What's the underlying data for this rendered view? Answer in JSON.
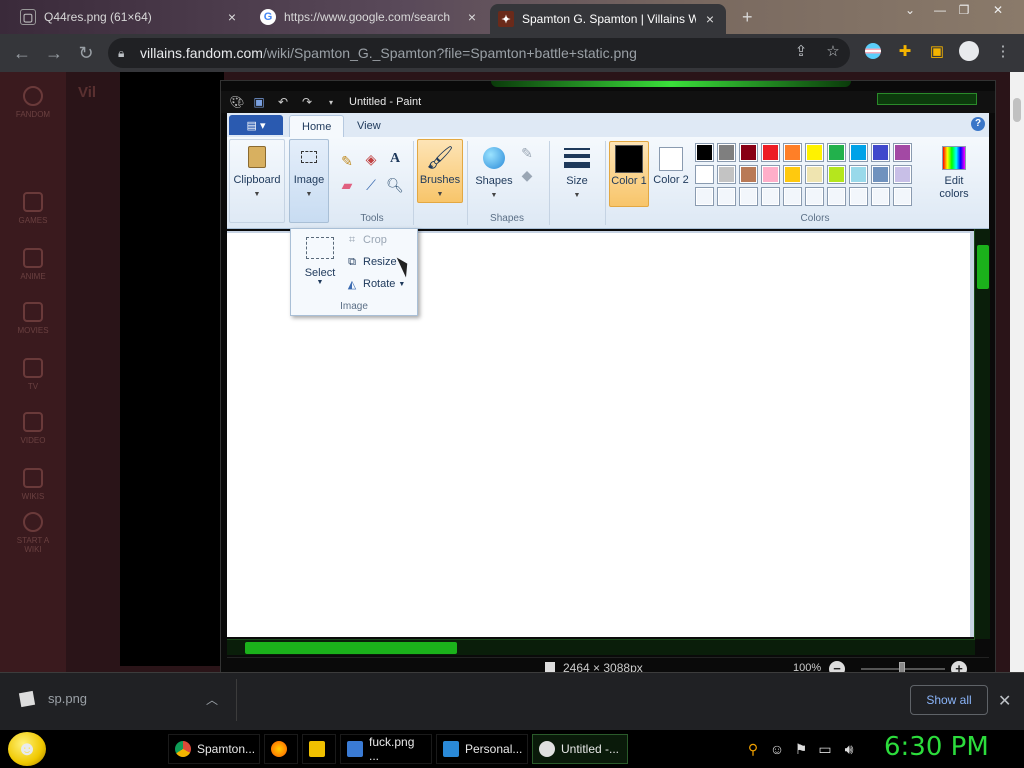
{
  "browser": {
    "tabs": [
      {
        "title": "Q44res.png (61×64)",
        "icon": "image-tab-icon"
      },
      {
        "title": "https://www.google.com/search",
        "icon": "google-icon"
      },
      {
        "title": "Spamton G. Spamton | Villains W",
        "icon": "fandom-icon"
      }
    ],
    "new_tab": "+",
    "url_host": "villains.fandom.com",
    "url_path": "/wiki/Spamton_G._Spamton?file=Spamton+battle+static.png"
  },
  "webpage": {
    "rail": [
      "FANDOM",
      "GAMES",
      "ANIME",
      "MOVIES",
      "TV",
      "VIDEO",
      "WIKIS",
      "START A WIKI"
    ],
    "logo_text": "Vil"
  },
  "paint": {
    "title": "Untitled - Paint",
    "tabs": [
      "Home",
      "View"
    ],
    "help": "?",
    "clipboard_label": "Clipboard",
    "image_label": "Image",
    "tools_label": "Tools",
    "brushes_label": "Brushes",
    "shapes_label": "Shapes",
    "shapes_group": "Shapes",
    "size_label": "Size",
    "color1_label": "Color 1",
    "color2_label": "Color 2",
    "colors_group": "Colors",
    "edit_colors_label": "Edit colors",
    "palette": [
      "#000000",
      "#7f7f7f",
      "#880015",
      "#ed1c24",
      "#ff7f27",
      "#fff200",
      "#22b14c",
      "#00a2e8",
      "#3f48cc",
      "#a349a4",
      "#ffffff",
      "#c3c3c3",
      "#b97a57",
      "#ffaec9",
      "#ffc90e",
      "#efe4b0",
      "#b5e61d",
      "#99d9ea",
      "#7092be",
      "#c8bfe7"
    ],
    "color1": "#000000",
    "color2": "#ffffff",
    "image_menu": {
      "select_label": "Select",
      "crop_label": "Crop",
      "resize_label": "Resize",
      "rotate_label": "Rotate",
      "group_label": "Image"
    },
    "status": {
      "dimensions": "2464 × 3088px",
      "zoom": "100%"
    }
  },
  "downloads": {
    "file": "sp.png",
    "show_all": "Show all"
  },
  "taskbar": {
    "items": [
      {
        "label": "Spamton...",
        "color": "#dd4b39"
      },
      {
        "label": "",
        "color": "#ff7a00"
      },
      {
        "label": "",
        "color": "#f0c000"
      },
      {
        "label": "fuck.png ...",
        "color": "#3a7bd5"
      },
      {
        "label": "Personal...",
        "color": "#2a8ad8"
      },
      {
        "label": "Untitled -...",
        "color": "#e0e0e0"
      }
    ],
    "clock": "6:30 PM"
  }
}
